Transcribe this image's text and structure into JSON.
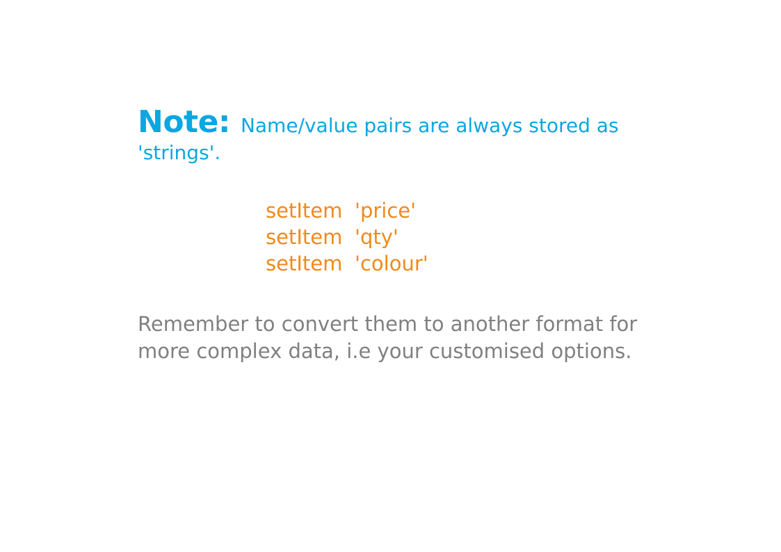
{
  "colors": {
    "note": "#0aa7e0",
    "code": "#ef8a1a",
    "reminder": "#808080",
    "background": "#ffffff"
  },
  "note": {
    "label": "Note:",
    "text": "Name/value pairs are always stored as 'strings'."
  },
  "code_lines": [
    {
      "method": "setItem",
      "arg": "'price'"
    },
    {
      "method": "setItem",
      "arg": "'qty'"
    },
    {
      "method": "setItem",
      "arg": "'colour'"
    }
  ],
  "reminder": {
    "text": "Remember to convert them to another format for more complex data, i.e your customised options."
  }
}
